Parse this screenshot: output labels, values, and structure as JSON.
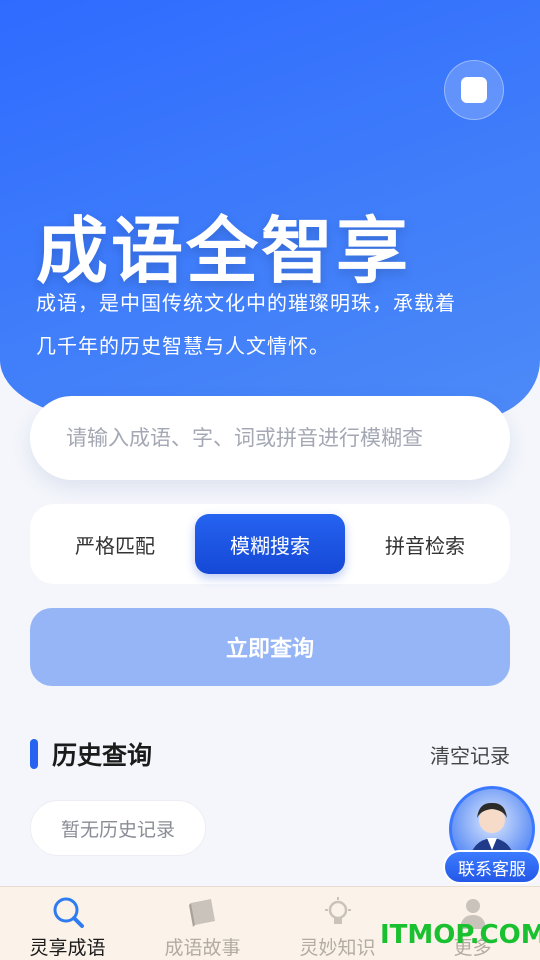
{
  "hero": {
    "title": "成语全智享",
    "description": "成语，是中国传统文化中的璀璨明珠，承载着几千年的历史智慧与人文情怀。",
    "top_button_icon": "square-icon"
  },
  "search": {
    "placeholder": "请输入成语、字、词或拼音进行模糊查",
    "value": ""
  },
  "modes": [
    {
      "label": "严格匹配",
      "active": false
    },
    {
      "label": "模糊搜索",
      "active": true
    },
    {
      "label": "拼音检索",
      "active": false
    }
  ],
  "query_button": {
    "label": "立即查询"
  },
  "history": {
    "title": "历史查询",
    "clear_label": "清空记录",
    "empty_label": "暂无历史记录"
  },
  "service": {
    "label": "联系客服",
    "icon": "customer-service-avatar-icon"
  },
  "tabs": [
    {
      "label": "灵享成语",
      "icon": "search-icon",
      "active": true
    },
    {
      "label": "成语故事",
      "icon": "book-icon",
      "active": false
    },
    {
      "label": "灵妙知识",
      "icon": "lightbulb-icon",
      "active": false
    },
    {
      "label": "更多",
      "icon": "person-icon",
      "active": false
    }
  ],
  "watermark": {
    "text": "ITMOP.COM"
  },
  "colors": {
    "primary": "#2563f0",
    "hero": "#3a78fb",
    "query_button": "#95b5f6",
    "tabbar_bg": "#fbf3ea",
    "watermark": "#19c02f"
  }
}
